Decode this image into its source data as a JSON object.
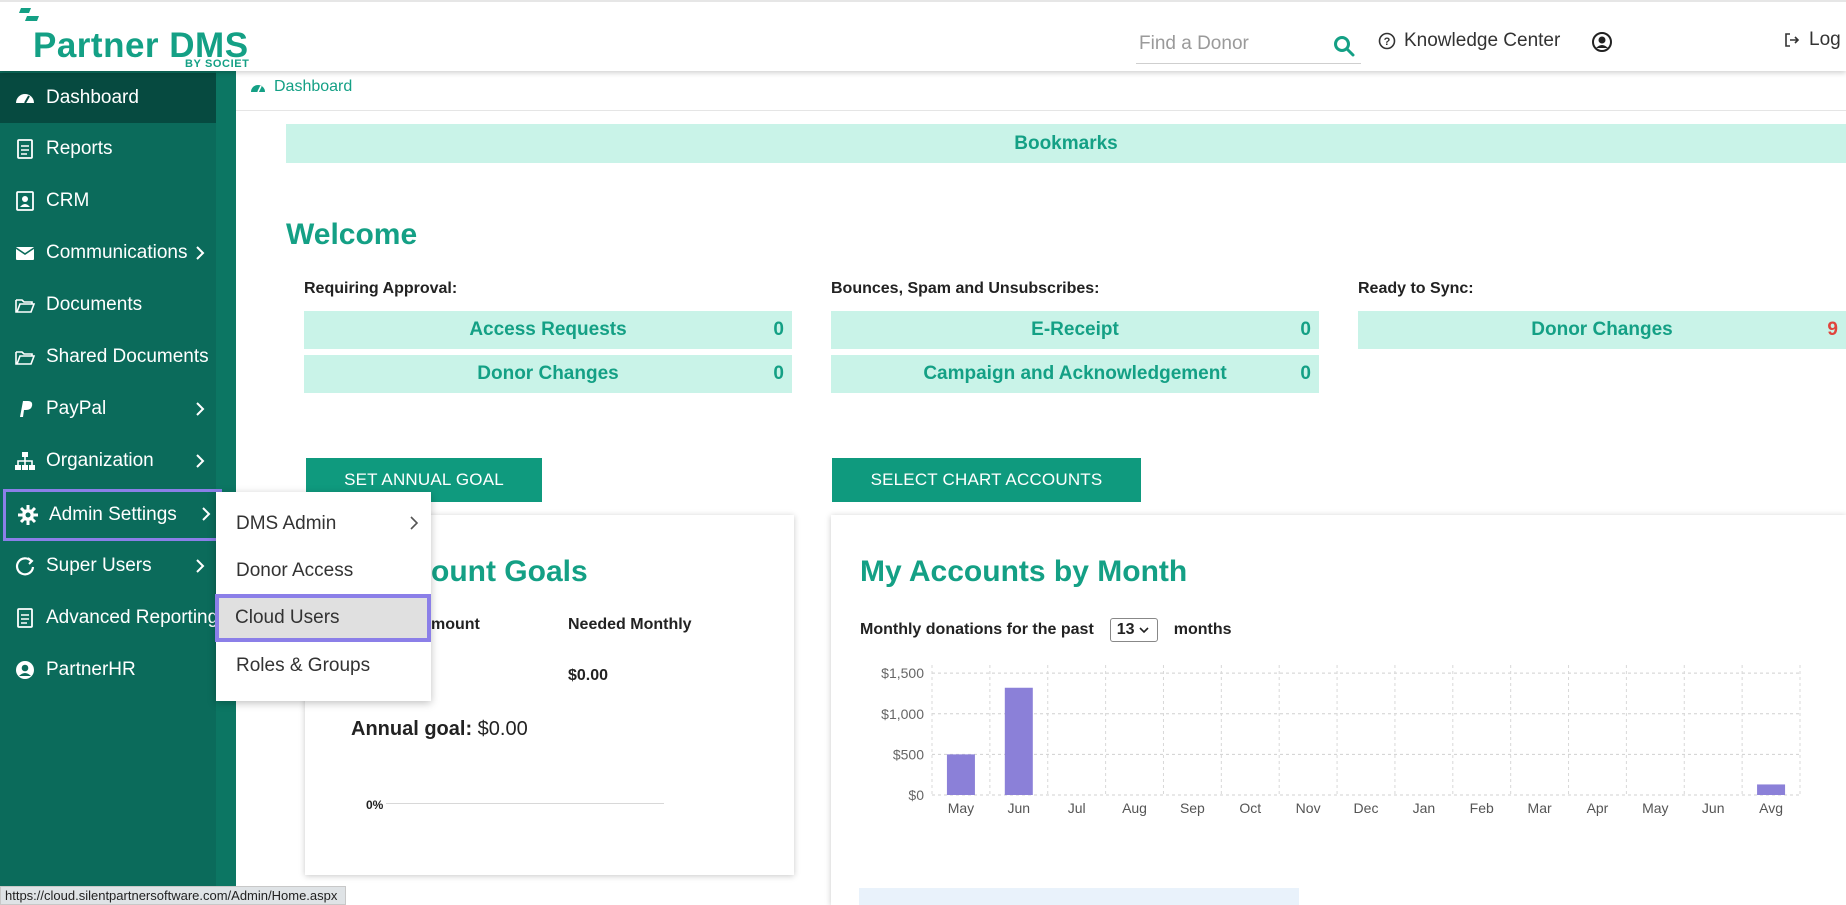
{
  "brand": {
    "name": "Partner DMS",
    "sub": "BY SOCIET"
  },
  "header": {
    "search_placeholder": "Find a Donor",
    "knowledge_center": "Knowledge Center",
    "logout": "Log"
  },
  "sidebar": {
    "items": [
      {
        "label": "Dashboard"
      },
      {
        "label": "Reports"
      },
      {
        "label": "CRM"
      },
      {
        "label": "Communications"
      },
      {
        "label": "Documents"
      },
      {
        "label": "Shared Documents"
      },
      {
        "label": "PayPal"
      },
      {
        "label": "Organization"
      },
      {
        "label": "Admin Settings"
      },
      {
        "label": "Super Users"
      },
      {
        "label": "Advanced Reporting"
      },
      {
        "label": "PartnerHR"
      }
    ]
  },
  "flyout": {
    "items": [
      {
        "label": "DMS Admin"
      },
      {
        "label": "Donor Access"
      },
      {
        "label": "Cloud Users"
      },
      {
        "label": "Roles & Groups"
      }
    ]
  },
  "breadcrumb": "Dashboard",
  "bookmarks": "Bookmarks",
  "welcome": "Welcome",
  "groups": {
    "approval": {
      "title": "Requiring Approval:",
      "rows": [
        {
          "label": "Access Requests",
          "count": "0"
        },
        {
          "label": "Donor Changes",
          "count": "0"
        }
      ]
    },
    "bounces": {
      "title": "Bounces, Spam and Unsubscribes:",
      "rows": [
        {
          "label": "E-Receipt",
          "count": "0"
        },
        {
          "label": "Campaign and Acknowledgement",
          "count": "0"
        }
      ]
    },
    "sync": {
      "title": "Ready to Sync:",
      "rows": [
        {
          "label": "Donor Changes",
          "count": "9"
        }
      ]
    }
  },
  "buttons": {
    "set_goal": "SET ANNUAL GOAL",
    "select_accounts": "SELECT CHART ACCOUNTS"
  },
  "goals_card": {
    "title": "ount Goals",
    "col_amount": "mount",
    "col_needed": "Needed Monthly",
    "needed_value": "$0.00",
    "annual_label": "Annual goal:",
    "annual_value": "$0.00",
    "progress": "0%"
  },
  "accounts_card": {
    "title": "My Accounts by Month",
    "monthly_prefix": "Monthly donations for the past",
    "months_value": "13",
    "monthly_suffix": "months"
  },
  "chart_data": {
    "type": "bar",
    "categories": [
      "May",
      "Jun",
      "Jul",
      "Aug",
      "Sep",
      "Oct",
      "Nov",
      "Dec",
      "Jan",
      "Feb",
      "Mar",
      "Apr",
      "May",
      "Jun",
      "Avg"
    ],
    "values": [
      500,
      1320,
      0,
      0,
      0,
      0,
      0,
      0,
      0,
      0,
      0,
      0,
      0,
      0,
      130
    ],
    "yticks": [
      "$1,500",
      "$1,000",
      "$500",
      "$0"
    ],
    "ylim": [
      0,
      1600
    ],
    "grid": true,
    "color": "#8b80d8"
  },
  "status_url": "https://cloud.silentpartnersoftware.com/Admin/Home.aspx",
  "colors": {
    "primary": "#0f9a7e",
    "sidebar": "#0b6b5b",
    "active": "#064a40",
    "highlight": "#8b7fe8",
    "tile": "#c9f3e8"
  }
}
